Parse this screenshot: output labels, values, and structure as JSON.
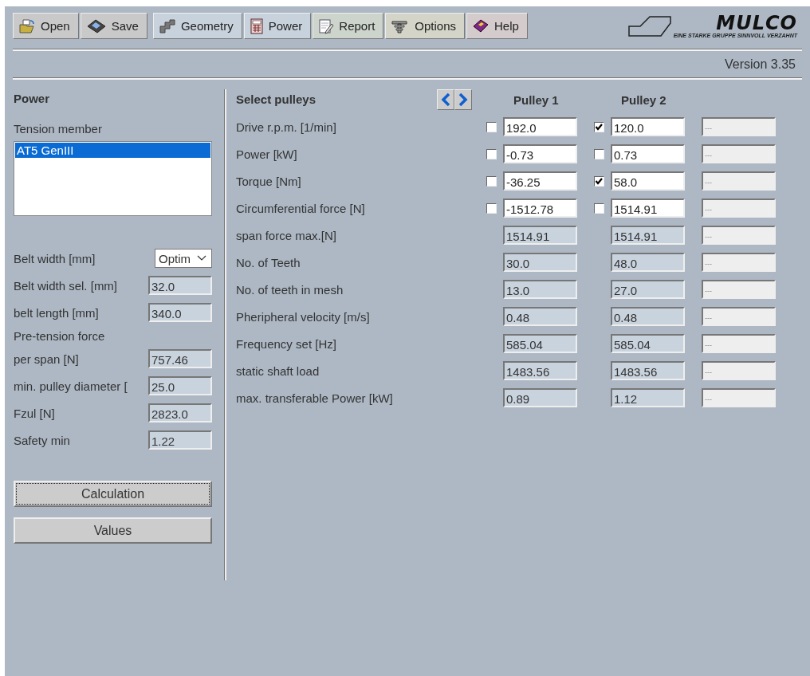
{
  "toolbar": {
    "buttons": [
      {
        "label": "Open"
      },
      {
        "label": "Save"
      },
      {
        "label": "Geometry"
      },
      {
        "label": "Power"
      },
      {
        "label": "Report"
      },
      {
        "label": "Options"
      },
      {
        "label": "Help"
      }
    ]
  },
  "logo": {
    "name": "MULCO",
    "tagline": "EINE STARKE GRUPPE SINNVOLL VERZAHNT"
  },
  "version": "Version 3.35",
  "left_panel": {
    "title": "Power",
    "tension_member_label": "Tension member",
    "tension_members": [
      {
        "label": "AT5 GenIII",
        "selected": true
      }
    ],
    "fields": [
      {
        "kind": "dropdown",
        "label": "Belt width [mm]",
        "value": "Optim"
      },
      {
        "kind": "output",
        "label": "Belt width sel. [mm]",
        "value": "32.0"
      },
      {
        "kind": "output",
        "label": "belt length [mm]",
        "value": "340.0"
      },
      {
        "kind": "heading",
        "label": "Pre-tension force"
      },
      {
        "kind": "output",
        "label": "per span [N]",
        "value": "757.46"
      },
      {
        "kind": "output",
        "label": "min. pulley diameter [",
        "value": "25.0"
      },
      {
        "kind": "output",
        "label": "Fzul [N]",
        "value": "2823.0"
      },
      {
        "kind": "output",
        "label": "Safety min",
        "value": "1.22"
      }
    ],
    "buttons": [
      {
        "label": "Calculation",
        "focused": true
      },
      {
        "label": "Values",
        "focused": false
      }
    ]
  },
  "pulleys": {
    "title": "Select pulleys",
    "columns": [
      "Pulley 1",
      "Pulley 2"
    ],
    "rows": [
      {
        "kind": "input",
        "label": "Drive r.p.m. [1/min]",
        "cells": [
          {
            "checked": false,
            "value": "192.0"
          },
          {
            "checked": true,
            "value": "120.0"
          }
        ],
        "extra": "---"
      },
      {
        "kind": "input",
        "label": "Power [kW]",
        "cells": [
          {
            "checked": false,
            "value": "-0.73"
          },
          {
            "checked": false,
            "value": "0.73"
          }
        ],
        "extra": "---"
      },
      {
        "kind": "input",
        "label": "Torque [Nm]",
        "cells": [
          {
            "checked": false,
            "value": "-36.25"
          },
          {
            "checked": true,
            "value": "58.0"
          }
        ],
        "extra": "---"
      },
      {
        "kind": "input",
        "label": "Circumferential force [N]",
        "cells": [
          {
            "checked": false,
            "value": "-1512.78"
          },
          {
            "checked": false,
            "value": "1514.91"
          }
        ],
        "extra": "---"
      },
      {
        "kind": "output",
        "label": "span force max.[N]",
        "cells": [
          {
            "value": "1514.91"
          },
          {
            "value": "1514.91"
          }
        ],
        "extra": "---"
      },
      {
        "kind": "output",
        "label": "No. of Teeth",
        "cells": [
          {
            "value": "30.0"
          },
          {
            "value": "48.0"
          }
        ],
        "extra": "---"
      },
      {
        "kind": "output",
        "label": "No. of teeth in mesh",
        "cells": [
          {
            "value": "13.0"
          },
          {
            "value": "27.0"
          }
        ],
        "extra": "---"
      },
      {
        "kind": "output",
        "label": "Pheripheral velocity [m/s]",
        "cells": [
          {
            "value": "0.48"
          },
          {
            "value": "0.48"
          }
        ],
        "extra": "---"
      },
      {
        "kind": "output",
        "label": "Frequency set [Hz]",
        "cells": [
          {
            "value": "585.04"
          },
          {
            "value": "585.04"
          }
        ],
        "extra": "---"
      },
      {
        "kind": "output",
        "label": "static shaft load",
        "cells": [
          {
            "value": "1483.56"
          },
          {
            "value": "1483.56"
          }
        ],
        "extra": "---"
      },
      {
        "kind": "output",
        "label": "max. transferable Power [kW]",
        "cells": [
          {
            "value": "0.89"
          },
          {
            "value": "1.12"
          }
        ],
        "extra": "---"
      }
    ]
  }
}
